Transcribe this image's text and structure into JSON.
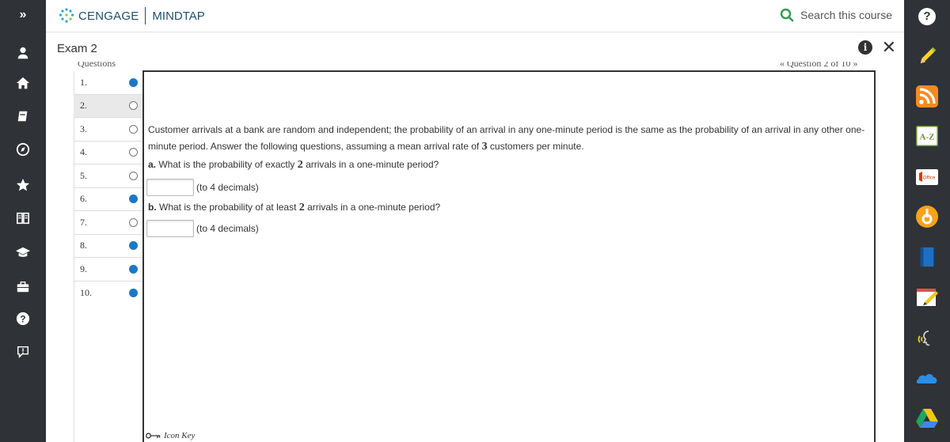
{
  "header": {
    "brand_name": "CENGAGE",
    "product_name": "MINDTAP",
    "search_placeholder": "Search this course",
    "help_label": "?"
  },
  "left_rail": {
    "expand_label": "»",
    "icons": [
      "user-icon",
      "home-icon",
      "notebook-icon",
      "compass-icon",
      "star-icon",
      "book-icon",
      "graduation-cap-icon",
      "briefcase-icon",
      "help-icon",
      "feedback-icon"
    ]
  },
  "exam": {
    "title": "Exam 2",
    "info_label": "i",
    "close_label": "✕",
    "questions_header": "Questions",
    "nav_label": "« Question 2 of 10 »"
  },
  "questions": [
    {
      "number": "1.",
      "status": "done"
    },
    {
      "number": "2.",
      "status": "open",
      "active": true
    },
    {
      "number": "3.",
      "status": "open"
    },
    {
      "number": "4.",
      "status": "open"
    },
    {
      "number": "5.",
      "status": "open"
    },
    {
      "number": "6.",
      "status": "done"
    },
    {
      "number": "7.",
      "status": "open"
    },
    {
      "number": "8.",
      "status": "done"
    },
    {
      "number": "9.",
      "status": "done"
    },
    {
      "number": "10.",
      "status": "done"
    }
  ],
  "question": {
    "text_1": "Customer arrivals at a bank are random and independent; the probability of an arrival in any one-minute period is the same as the probability of an arrival in any other one-minute period. Answer the following questions, assuming a mean arrival rate of ",
    "rate": "3",
    "text_2": " customers per minute.",
    "part_a_label": "a.",
    "part_a_text_1": " What is the probability of exactly ",
    "part_a_value": "2",
    "part_a_text_2": " arrivals in a one-minute period?",
    "part_a_answer": "",
    "part_a_hint": "(to 4 decimals)",
    "part_b_label": "b.",
    "part_b_text_1": " What is the probability of at least ",
    "part_b_value": "2",
    "part_b_text_2": " arrivals in a one-minute period?",
    "part_b_answer": "",
    "part_b_hint": "(to 4 decimals)",
    "icon_key_label": "Icon Key"
  },
  "right_rail": {
    "apps": [
      "pencil-app",
      "rss-app",
      "a-z-dictionary-app",
      "office-app",
      "merriam-app",
      "book-app",
      "notes-app",
      "readspeaker-app",
      "onedrive-app",
      "google-drive-app"
    ],
    "az_label": "A-Z",
    "office_label": "Office"
  },
  "colors": {
    "rail_bg": "#2f3236",
    "brand": "#1e4f6e",
    "accent": "#1c78c6",
    "search_icon": "#2e9e4f"
  }
}
